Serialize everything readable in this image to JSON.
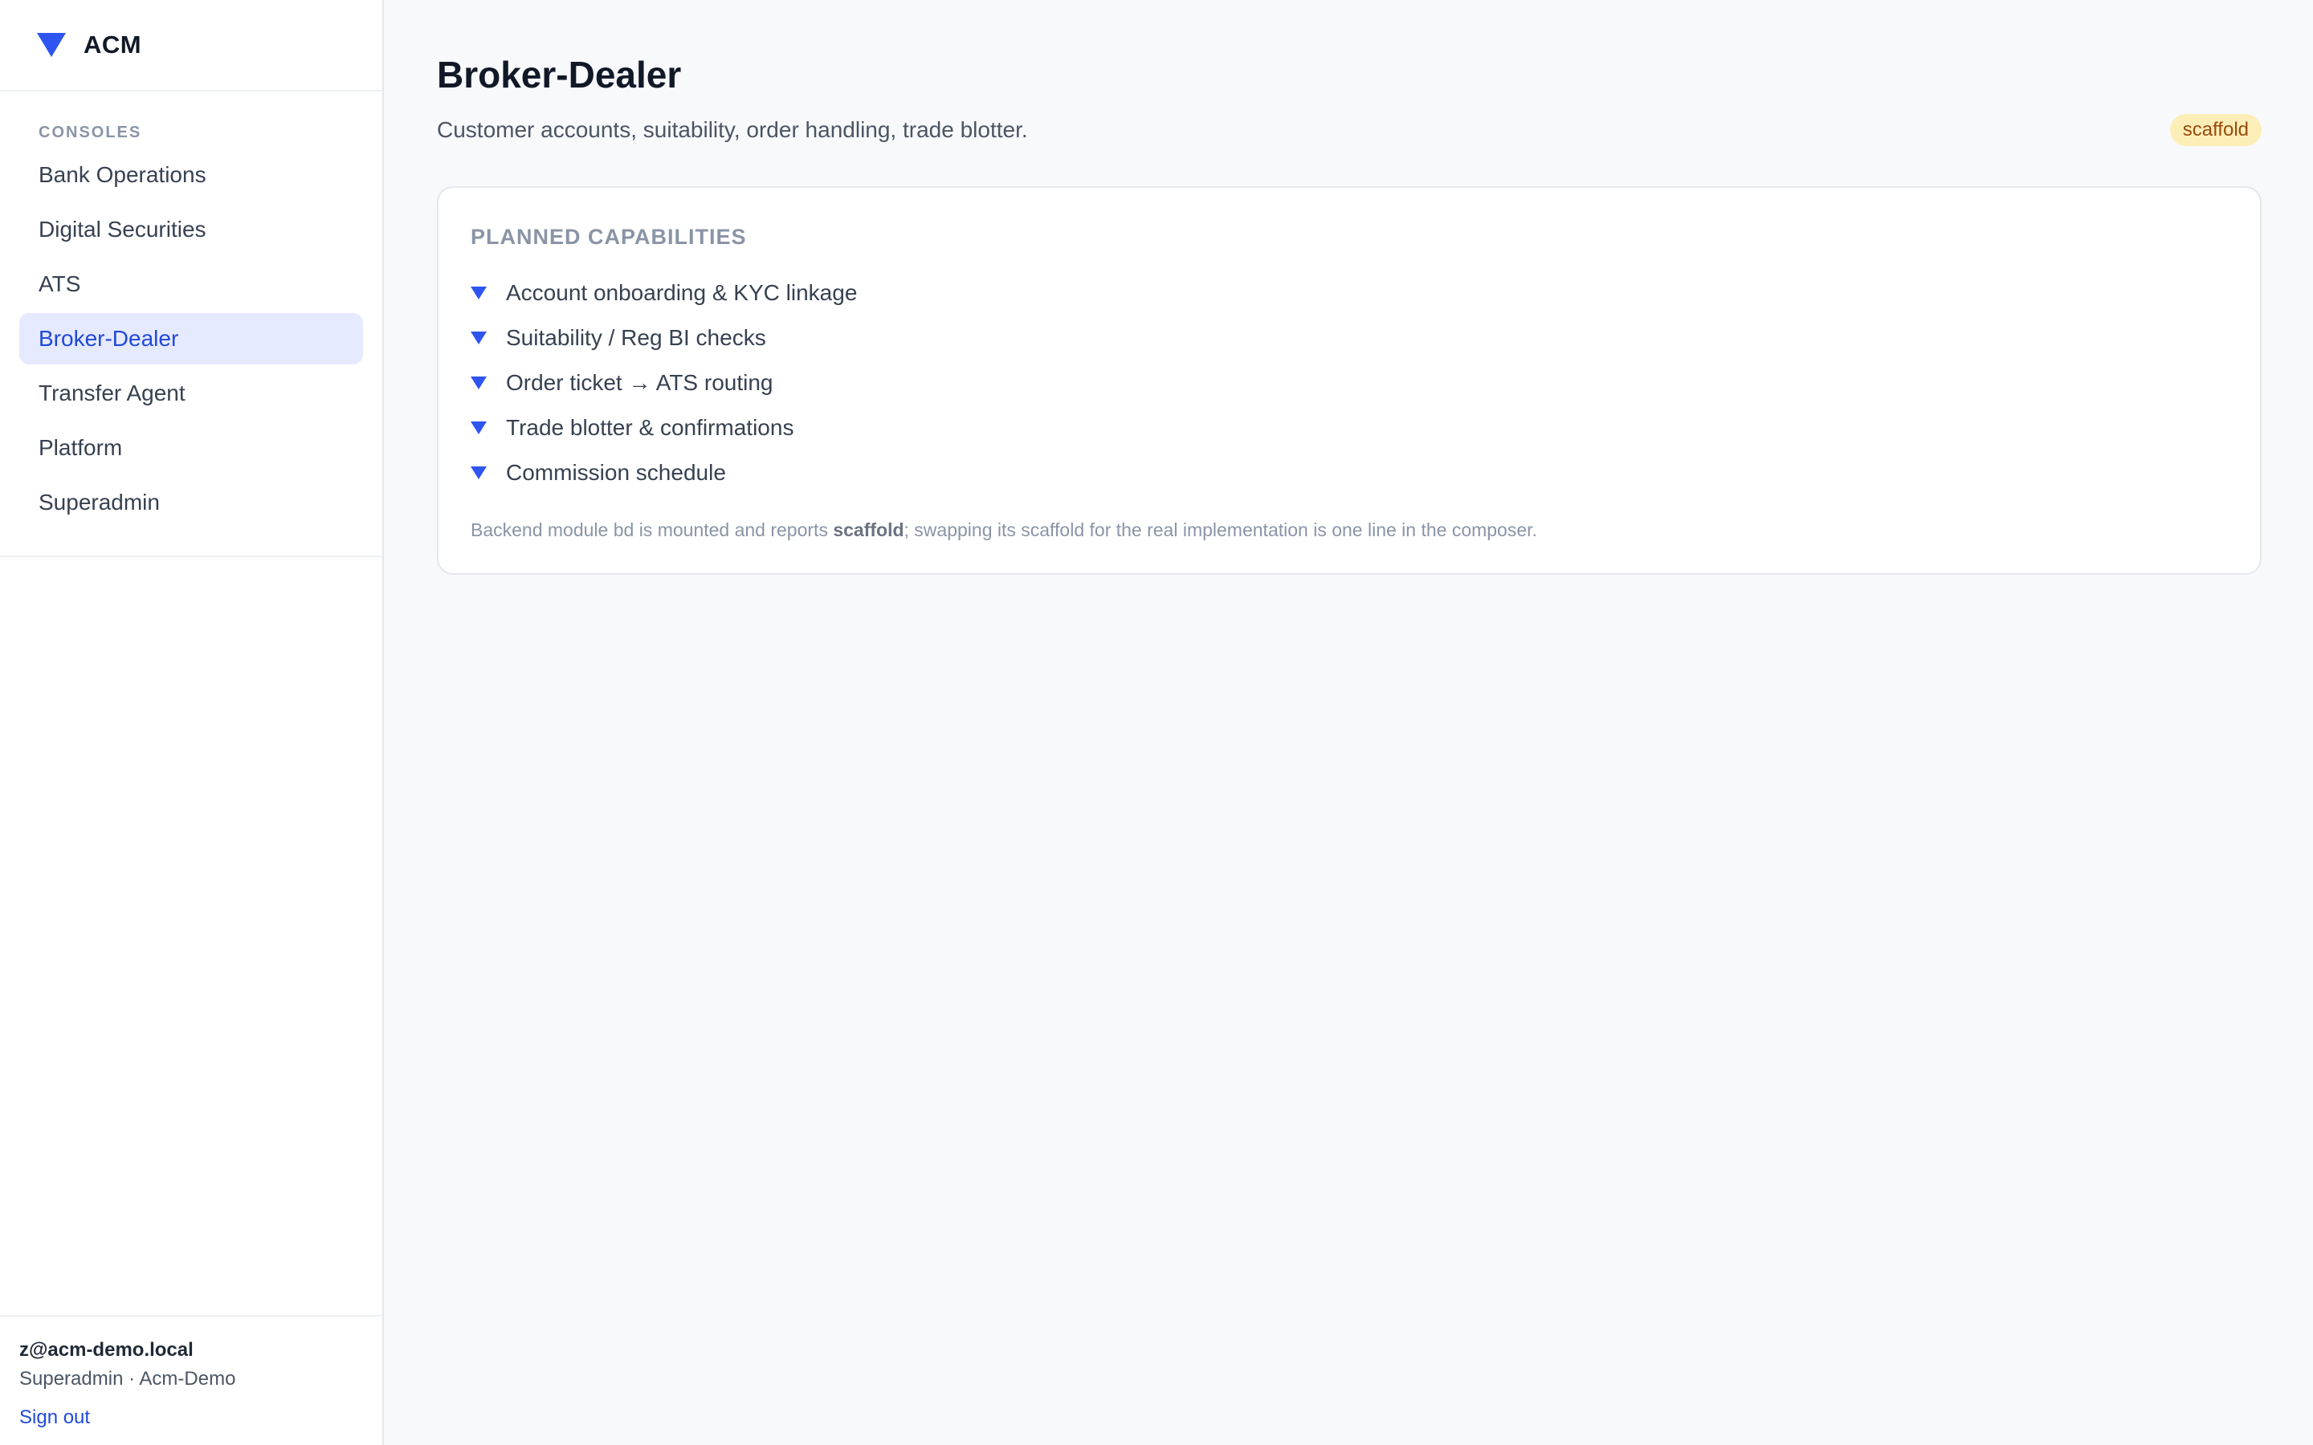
{
  "brand": {
    "name": "ACM",
    "logo_icon": "triangle-down-icon",
    "accent": "#2f55f0"
  },
  "sidebar": {
    "heading": "CONSOLES",
    "items": [
      {
        "label": "Bank Operations",
        "active": false
      },
      {
        "label": "Digital Securities",
        "active": false
      },
      {
        "label": "ATS",
        "active": false
      },
      {
        "label": "Broker-Dealer",
        "active": true
      },
      {
        "label": "Transfer Agent",
        "active": false
      },
      {
        "label": "Platform",
        "active": false
      },
      {
        "label": "Superadmin",
        "active": false
      }
    ],
    "user": {
      "email": "z@acm-demo.local",
      "role": "Superadmin · Acm-Demo",
      "signout_label": "Sign out"
    }
  },
  "main": {
    "title": "Broker-Dealer",
    "subtitle": "Customer accounts, suitability, order handling, trade blotter.",
    "badge": "scaffold",
    "card": {
      "title": "PLANNED CAPABILITIES",
      "items": [
        "Account onboarding & KYC linkage",
        "Suitability / Reg BI checks",
        "Order ticket → ATS routing",
        "Trade blotter & confirmations",
        "Commission schedule"
      ],
      "note_prefix": "Backend module bd is mounted and reports ",
      "note_bold": "scaffold",
      "note_suffix": "; swapping its scaffold for the real implementation is one line in the composer."
    }
  },
  "colors": {
    "accent": "#2f55f0",
    "active_bg": "#e6eafe",
    "active_text": "#2149d8",
    "badge_bg": "#fdeeb8",
    "badge_text": "#9a4a0b"
  }
}
